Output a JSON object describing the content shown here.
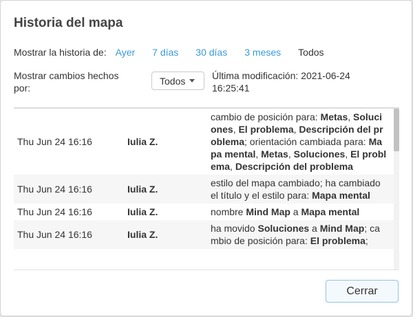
{
  "dialog": {
    "title": "Historia del mapa",
    "history_label": "Mostrar la historia de:",
    "periods": [
      "Ayer",
      "7 días",
      "30 días",
      "3 meses",
      "Todos"
    ],
    "changes_label": "Mostrar cambios hechos por:",
    "user_filter_value": "Todos",
    "last_modified": "Última modificación: 2021-06-24 16:25:41",
    "close_label": "Cerrar"
  },
  "rows": [
    {
      "date": "Thu Jun 24 16:16",
      "user": "Iulia Z.",
      "desc": [
        {
          "t": "cambio de posición para: ",
          "b": false
        },
        {
          "t": "Metas",
          "b": true
        },
        {
          "t": ", ",
          "b": false
        },
        {
          "t": "Soluciones",
          "b": true
        },
        {
          "t": ", ",
          "b": false
        },
        {
          "t": "El problema",
          "b": true
        },
        {
          "t": ", ",
          "b": false
        },
        {
          "t": "Descripción del problema",
          "b": true
        },
        {
          "t": "; orientación cambiada para: ",
          "b": false
        },
        {
          "t": "Mapa mental",
          "b": true
        },
        {
          "t": ", ",
          "b": false
        },
        {
          "t": "Metas",
          "b": true
        },
        {
          "t": ", ",
          "b": false
        },
        {
          "t": "Soluciones",
          "b": true
        },
        {
          "t": ", ",
          "b": false
        },
        {
          "t": "El problema",
          "b": true
        },
        {
          "t": ", ",
          "b": false
        },
        {
          "t": "Descripción del problema",
          "b": true
        }
      ]
    },
    {
      "date": "Thu Jun 24 16:16",
      "user": "Iulia Z.",
      "desc": [
        {
          "t": "estilo del mapa cambiado; ha cambiado el título y el estilo para: ",
          "b": false
        },
        {
          "t": "Mapa mental",
          "b": true
        }
      ]
    },
    {
      "date": "Thu Jun 24 16:16",
      "user": "Iulia Z.",
      "desc": [
        {
          "t": "nombre ",
          "b": false
        },
        {
          "t": "Mind Map",
          "b": true
        },
        {
          "t": " a ",
          "b": false
        },
        {
          "t": "Mapa mental",
          "b": true
        }
      ]
    },
    {
      "date": "Thu Jun 24 16:16",
      "user": "Iulia Z.",
      "desc": [
        {
          "t": "ha movido ",
          "b": false
        },
        {
          "t": "Soluciones",
          "b": true
        },
        {
          "t": " a ",
          "b": false
        },
        {
          "t": "Mind Map",
          "b": true
        },
        {
          "t": "; cambio de posición para: ",
          "b": false
        },
        {
          "t": "El problema",
          "b": true
        },
        {
          "t": ";",
          "b": false
        }
      ]
    }
  ],
  "colors": {
    "link": "#3a9ad9",
    "button_border": "#8fc3e6"
  }
}
